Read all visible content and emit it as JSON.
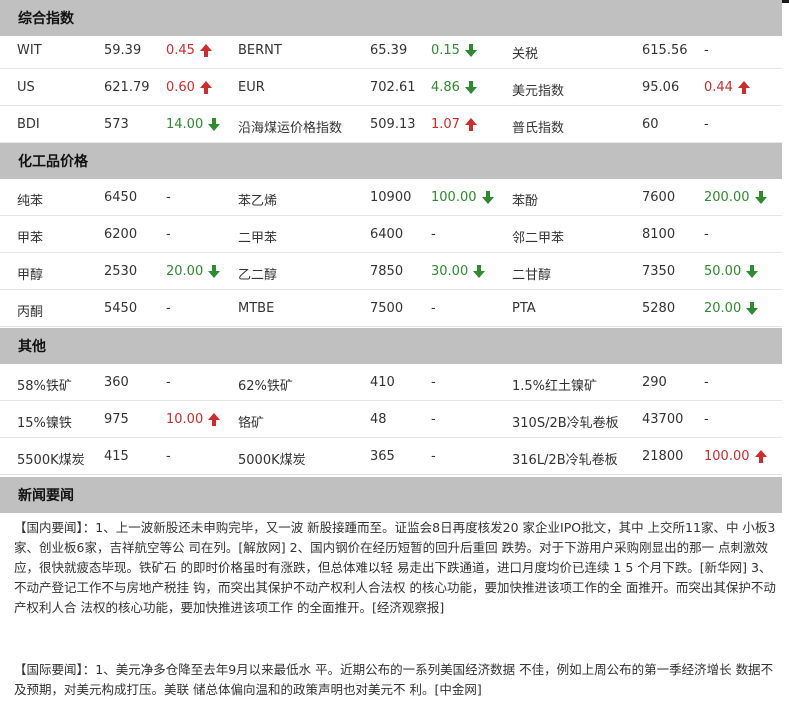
{
  "colors": {
    "up": "#d12b2b",
    "down": "#2e8b2e",
    "header_bg": "#c0c0c0"
  },
  "sections": {
    "composite": {
      "title": "综合指数",
      "rows": [
        [
          {
            "name": "WIT",
            "price": "59.39",
            "change": "0.45",
            "dir": "up"
          },
          {
            "name": "BERNT",
            "price": "65.39",
            "change": "0.15",
            "dir": "down"
          },
          {
            "name": "关税",
            "price": "615.56",
            "change": "-",
            "dir": "none"
          }
        ],
        [
          {
            "name": "US",
            "price": "621.79",
            "change": "0.60",
            "dir": "up"
          },
          {
            "name": "EUR",
            "price": "702.61",
            "change": "4.86",
            "dir": "down"
          },
          {
            "name": "美元指数",
            "price": "95.06",
            "change": "0.44",
            "dir": "up"
          }
        ],
        [
          {
            "name": "BDI",
            "price": "573",
            "change": "14.00",
            "dir": "down"
          },
          {
            "name": "沿海煤运价格指数",
            "price": "509.13",
            "change": "1.07",
            "dir": "up"
          },
          {
            "name": "普氏指数",
            "price": "60",
            "change": "-",
            "dir": "none"
          }
        ]
      ]
    },
    "chemical": {
      "title": "化工品价格",
      "rows": [
        [
          {
            "name": "纯苯",
            "price": "6450",
            "change": "-",
            "dir": "none"
          },
          {
            "name": "苯乙烯",
            "price": "10900",
            "change": "100.00",
            "dir": "down"
          },
          {
            "name": "苯酚",
            "price": "7600",
            "change": "200.00",
            "dir": "down"
          }
        ],
        [
          {
            "name": "甲苯",
            "price": "6200",
            "change": "-",
            "dir": "none"
          },
          {
            "name": "二甲苯",
            "price": "6400",
            "change": "-",
            "dir": "none"
          },
          {
            "name": "邻二甲苯",
            "price": "8100",
            "change": "-",
            "dir": "none"
          }
        ],
        [
          {
            "name": "甲醇",
            "price": "2530",
            "change": "20.00",
            "dir": "down"
          },
          {
            "name": "乙二醇",
            "price": "7850",
            "change": "30.00",
            "dir": "down"
          },
          {
            "name": "二甘醇",
            "price": "7350",
            "change": "50.00",
            "dir": "down"
          }
        ],
        [
          {
            "name": "丙酮",
            "price": "5450",
            "change": "-",
            "dir": "none"
          },
          {
            "name": "MTBE",
            "price": "7500",
            "change": "-",
            "dir": "none"
          },
          {
            "name": "PTA",
            "price": "5280",
            "change": "20.00",
            "dir": "down"
          }
        ]
      ]
    },
    "other": {
      "title": "其他",
      "rows": [
        [
          {
            "name": "58%铁矿",
            "price": "360",
            "change": "-",
            "dir": "none"
          },
          {
            "name": "62%铁矿",
            "price": "410",
            "change": "-",
            "dir": "none"
          },
          {
            "name": "1.5%红土镍矿",
            "price": "290",
            "change": "-",
            "dir": "none"
          }
        ],
        [
          {
            "name": "15%镍铁",
            "price": "975",
            "change": "10.00",
            "dir": "up"
          },
          {
            "name": "铬矿",
            "price": "48",
            "change": "-",
            "dir": "none"
          },
          {
            "name": "310S/2B冷轧卷板",
            "price": "43700",
            "change": "-",
            "dir": "none"
          }
        ],
        [
          {
            "name": "5500K煤炭",
            "price": "415",
            "change": "-",
            "dir": "none"
          },
          {
            "name": "5000K煤炭",
            "price": "365",
            "change": "-",
            "dir": "none"
          },
          {
            "name": "316L/2B冷轧卷板",
            "price": "21800",
            "change": "100.00",
            "dir": "up"
          }
        ]
      ]
    },
    "news": {
      "title": "新闻要闻",
      "domestic": "【国内要闻】：1、上一波新股还未申购完毕，又一波 新股接踵而至。证监会8日再度核发20 家企业IPO批文，其中 上交所11家、中 小板3家、创业板6家，吉祥航空等公 司在列。[解放网] 2、国内钢价在经历短暂的回升后重回 跌势。对于下游用户采购刚显出的那一 点刺激效应，很快就疲态毕现。铁矿石 的即时价格虽时有涨跌，但总体难以轻 易走出下跌通道，进口月度均价已连续 1 5 个月下跌。[新华网] 3、不动产登记工作不与房地产税挂 钩，而突出其保护不动产权利人合法权 的核心功能，要加快推进该项工作的全 面推开。而突出其保护不动产权利人合 法权的核心功能，要加快推进该项工作 的全面推开。[经济观察报]",
      "international": "【国际要闻】：1、美元净多仓降至去年9月以来最低水 平。近期公布的一系列美国经济数据 不佳，例如上周公布的第一季经济增长 数据不及预期，对美元构成打压。美联 储总体偏向温和的政策声明也对美元不 利。[中金网]"
    }
  }
}
